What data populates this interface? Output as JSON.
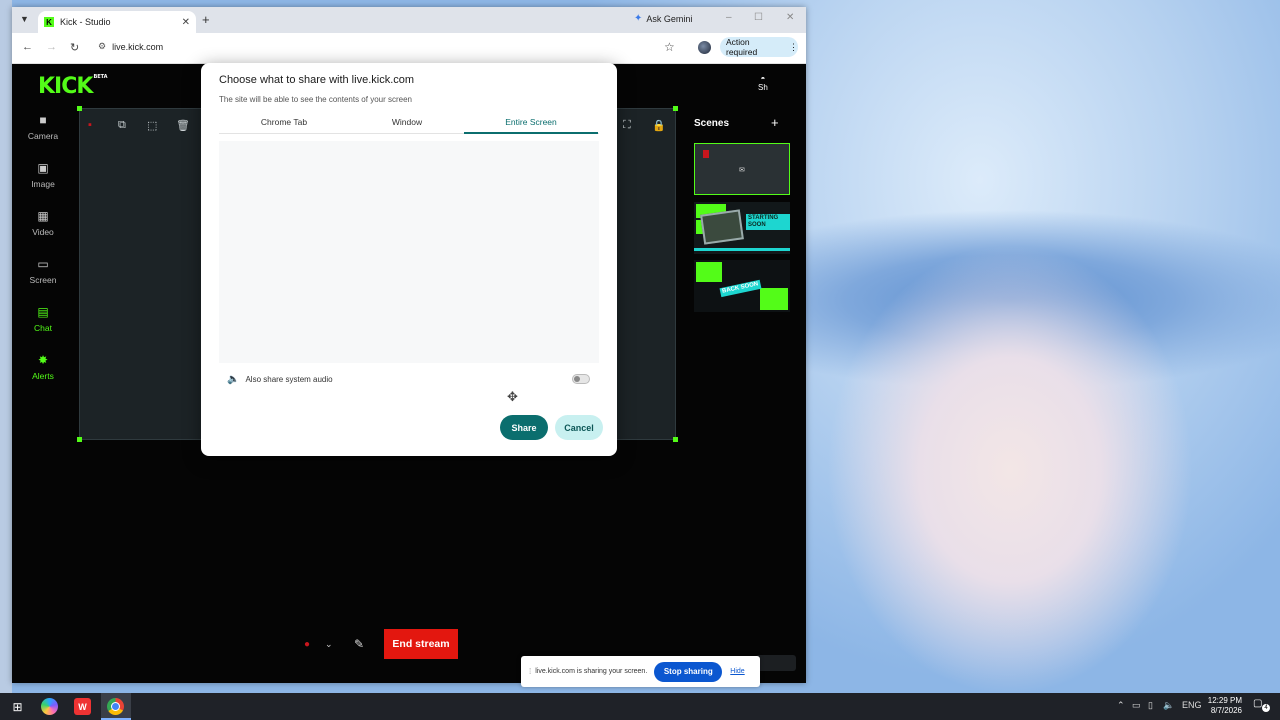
{
  "browser": {
    "tab_title": "Kick - Studio",
    "tab_favicon": "K",
    "tab_close": "✕",
    "new_tab": "+",
    "ask_gemini": "Ask Gemini",
    "url": "live.kick.com",
    "action_required": "Action required",
    "window_controls": [
      "–",
      "☐",
      "✕"
    ]
  },
  "kick": {
    "logo": "KICK",
    "logo_sup": "BETA",
    "sidebar": [
      {
        "label": "Camera",
        "icon": "camera-icon",
        "glyph": "■"
      },
      {
        "label": "Image",
        "icon": "image-icon",
        "glyph": "▣"
      },
      {
        "label": "Video",
        "icon": "video-icon",
        "glyph": "▦"
      },
      {
        "label": "Screen",
        "icon": "screen-icon",
        "glyph": "▭"
      },
      {
        "label": "Chat",
        "icon": "chat-icon",
        "glyph": "▤"
      },
      {
        "label": "Alerts",
        "icon": "alerts-icon",
        "glyph": "✸"
      }
    ],
    "scenes_title": "Scenes",
    "scenes_add": "+",
    "scene_labels": [
      "STARTING SOON",
      "BACK SOON"
    ],
    "avatar_text": "Sh",
    "end_stream": "End stream",
    "accent": "#53fc18",
    "end_stream_color": "#e3170f"
  },
  "dialog": {
    "title": "Choose what to share with live.kick.com",
    "subtitle": "The site will be able to see the contents of your screen",
    "tabs": [
      "Chrome Tab",
      "Window",
      "Entire Screen"
    ],
    "active_tab": "Entire Screen",
    "audio_label": "Also share system audio",
    "audio_enabled": false,
    "share": "Share",
    "cancel": "Cancel",
    "accent": "#0b6e6e"
  },
  "notice": {
    "text": "live.kick.com is sharing your screen.",
    "stop": "Stop sharing",
    "hide": "Hide"
  },
  "taskbar": {
    "lang": "ENG",
    "time": "12:29 PM",
    "date": "8/7/2026",
    "notifications": "4"
  }
}
